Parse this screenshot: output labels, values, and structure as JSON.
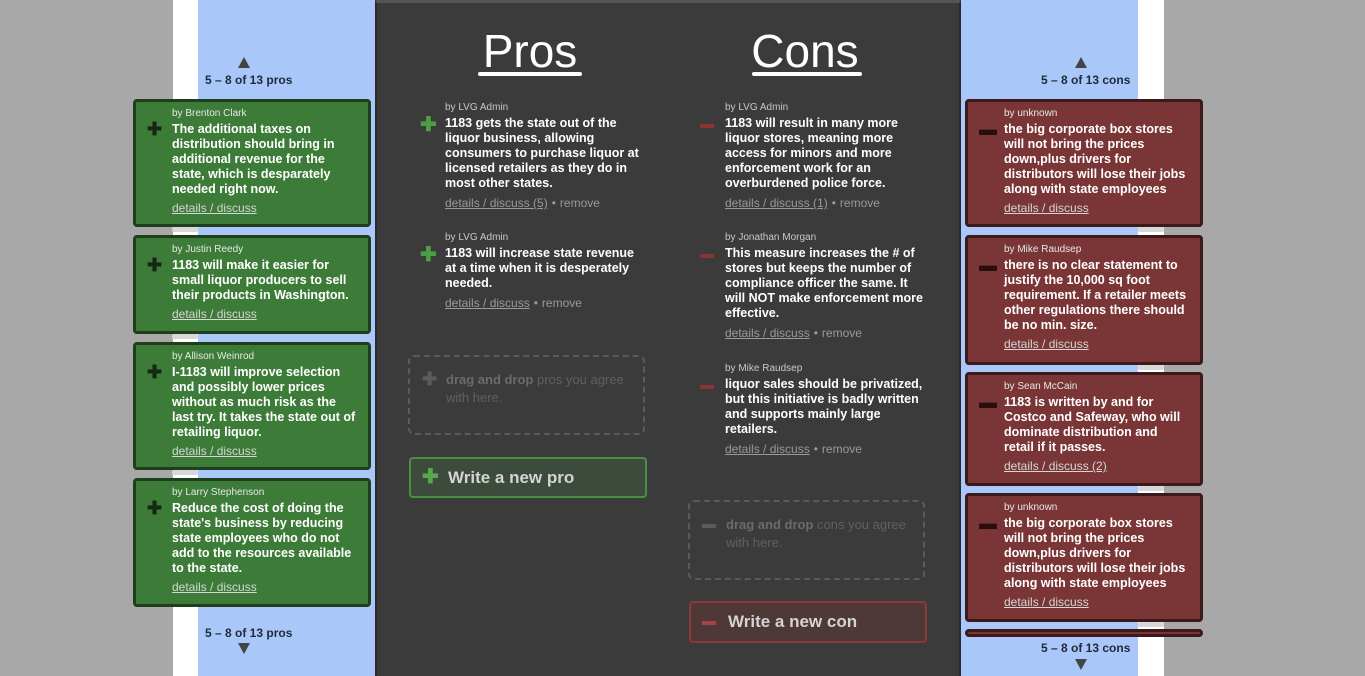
{
  "pros_pager": {
    "label": "5 – 8 of 13 pros"
  },
  "cons_pager": {
    "label": "5 – 8 of 13 cons"
  },
  "board": {
    "pros_title": "Pros",
    "cons_title": "Cons"
  },
  "side_pros": [
    {
      "by": "by Brenton Clark",
      "text": "The additional taxes on distribution should bring in additional revenue for the state, which is desparately needed right now.",
      "link": "details / discuss"
    },
    {
      "by": "by Justin Reedy",
      "text": "1183 will make it easier for small liquor producers to sell their products in Washington.",
      "link": "details / discuss"
    },
    {
      "by": "by Allison Weinrod",
      "text": "I-1183 will improve selection and possibly lower prices without as much risk as the last try. It takes the state out of retailing liquor.",
      "link": "details / discuss"
    },
    {
      "by": "by Larry Stephenson",
      "text": "Reduce the cost of doing the state's business by reducing state employees who do not add to the resources available to the state.",
      "link": "details / discuss"
    }
  ],
  "side_cons": [
    {
      "by": "by unknown",
      "text": "the big corporate box stores will not bring the prices down,plus drivers for distributors will lose their jobs along with state employees",
      "link": "details / discuss"
    },
    {
      "by": "by Mike Raudsep",
      "text": "there is no clear statement to justify the 10,000 sq foot requirement. If a retailer meets other regulations there should be no min. size.",
      "link": "details / discuss"
    },
    {
      "by": "by Sean McCain",
      "text": "1183 is written by and for Costco and Safeway, who will dominate distribution and retail if it passes.",
      "link": "details / discuss (2)"
    },
    {
      "by": "by unknown",
      "text": "the big corporate box stores will not bring the prices down,plus drivers for distributors will lose their jobs along with state employees",
      "link": "details / discuss"
    }
  ],
  "board_pros": [
    {
      "by": "by LVG Admin",
      "text": "1183 gets the state out of the liquor business, allowing consumers to purchase liquor at licensed retailers as they do in most other states.",
      "link": "details / discuss (5)",
      "sep": "•",
      "remove": "remove"
    },
    {
      "by": "by LVG Admin",
      "text": "1183 will increase state revenue at a time when it is desperately needed.",
      "link": "details / discuss",
      "sep": "•",
      "remove": "remove"
    }
  ],
  "board_cons": [
    {
      "by": "by LVG Admin",
      "text": "1183 will result in many more liquor stores, meaning more access for minors and more enforcement work for an overburdened police force.",
      "link": "details / discuss (1)",
      "sep": "•",
      "remove": "remove"
    },
    {
      "by": "by Jonathan Morgan",
      "text": "This measure increases the # of stores but keeps the number of compliance officer the same. It will NOT make enforcement more effective.",
      "link": "details / discuss",
      "sep": "•",
      "remove": "remove"
    },
    {
      "by": "by Mike Raudsep",
      "text": "liquor sales should be privatized, but this initiative is badly written and supports mainly large retailers.",
      "link": "details / discuss",
      "sep": "•",
      "remove": "remove"
    }
  ],
  "pro_drop": {
    "strong": "drag and drop",
    "rest": " pros you agree with here."
  },
  "con_drop": {
    "strong": "drag and drop",
    "rest": " cons you agree with here."
  },
  "write_pro": "Write a new pro",
  "write_con": "Write a new con"
}
